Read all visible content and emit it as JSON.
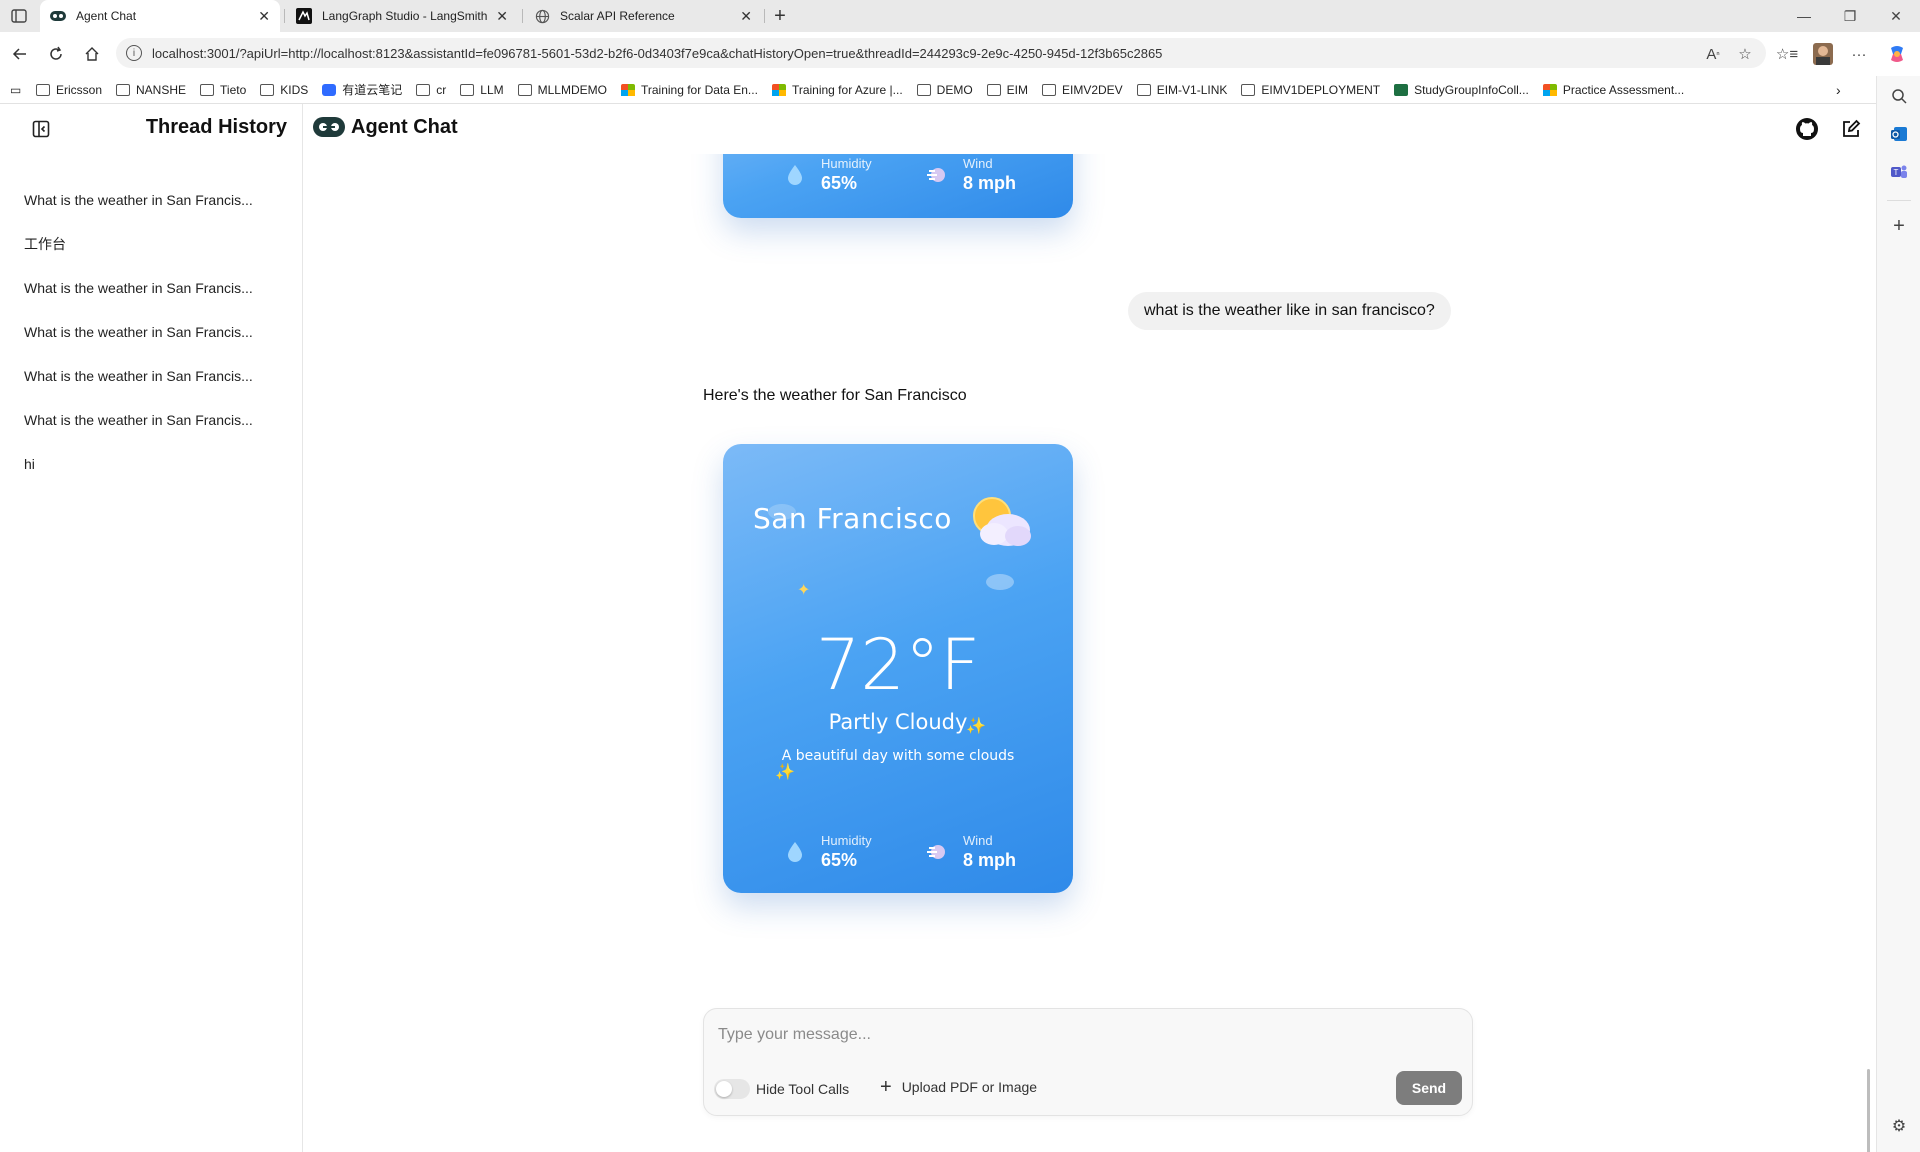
{
  "browser": {
    "tabs": [
      {
        "label": "Agent Chat",
        "active": true
      },
      {
        "label": "LangGraph Studio - LangSmith",
        "active": false
      },
      {
        "label": "Scalar API Reference",
        "active": false
      }
    ],
    "url": "localhost:3001/?apiUrl=http://localhost:8123&assistantId=fe096781-5601-53d2-b2f6-0d3403f7e9ca&chatHistoryOpen=true&threadId=244293c9-2e9c-4250-945d-12f3b65c2865",
    "bookmarks": [
      {
        "label": "Ericsson",
        "icon": "folder"
      },
      {
        "label": "NANSHE",
        "icon": "folder"
      },
      {
        "label": "Tieto",
        "icon": "folder"
      },
      {
        "label": "KIDS",
        "icon": "folder"
      },
      {
        "label": "有道云笔记",
        "icon": "youdao"
      },
      {
        "label": "cr",
        "icon": "folder"
      },
      {
        "label": "LLM",
        "icon": "folder"
      },
      {
        "label": "MLLMDEMO",
        "icon": "folder"
      },
      {
        "label": "Training for Data En...",
        "icon": "microsoft"
      },
      {
        "label": "Training for Azure |...",
        "icon": "microsoft"
      },
      {
        "label": "DEMO",
        "icon": "folder"
      },
      {
        "label": "EIM",
        "icon": "folder"
      },
      {
        "label": "EIMV2DEV",
        "icon": "folder"
      },
      {
        "label": "EIM-V1-LINK",
        "icon": "folder"
      },
      {
        "label": "EIMV1DEPLOYMENT",
        "icon": "folder"
      },
      {
        "label": "StudyGroupInfoColl...",
        "icon": "excel"
      },
      {
        "label": "Practice Assessment...",
        "icon": "microsoft"
      }
    ]
  },
  "sidebar": {
    "title": "Thread History",
    "threads": [
      "What is the weather in San Francis...",
      "工作台",
      "What is the weather in San Francis...",
      "What is the weather in San Francis...",
      "What is the weather in San Francis...",
      "What is the weather in San Francis...",
      "hi"
    ]
  },
  "header": {
    "title": "Agent Chat"
  },
  "messages": {
    "user": "what is the weather like in san francisco?",
    "assistant": "Here's the weather for San Francisco"
  },
  "weather_card_top": {
    "humidity_label": "Humidity",
    "humidity": "65%",
    "wind_label": "Wind",
    "wind": "8 mph"
  },
  "weather_card": {
    "city": "San Francisco",
    "temperature": "72°F",
    "condition": "Partly Cloudy",
    "description": "A beautiful day with some clouds",
    "humidity_label": "Humidity",
    "humidity": "65%",
    "wind_label": "Wind",
    "wind": "8 mph"
  },
  "composer": {
    "placeholder": "Type your message...",
    "hide_tool_calls_label": "Hide Tool Calls",
    "upload_label": "Upload PDF or Image",
    "send_label": "Send"
  },
  "colors": {
    "card_gradient_top": "#7cbaf7",
    "card_gradient_bottom": "#2f8ae9",
    "send_button": "#7d7d7d"
  }
}
